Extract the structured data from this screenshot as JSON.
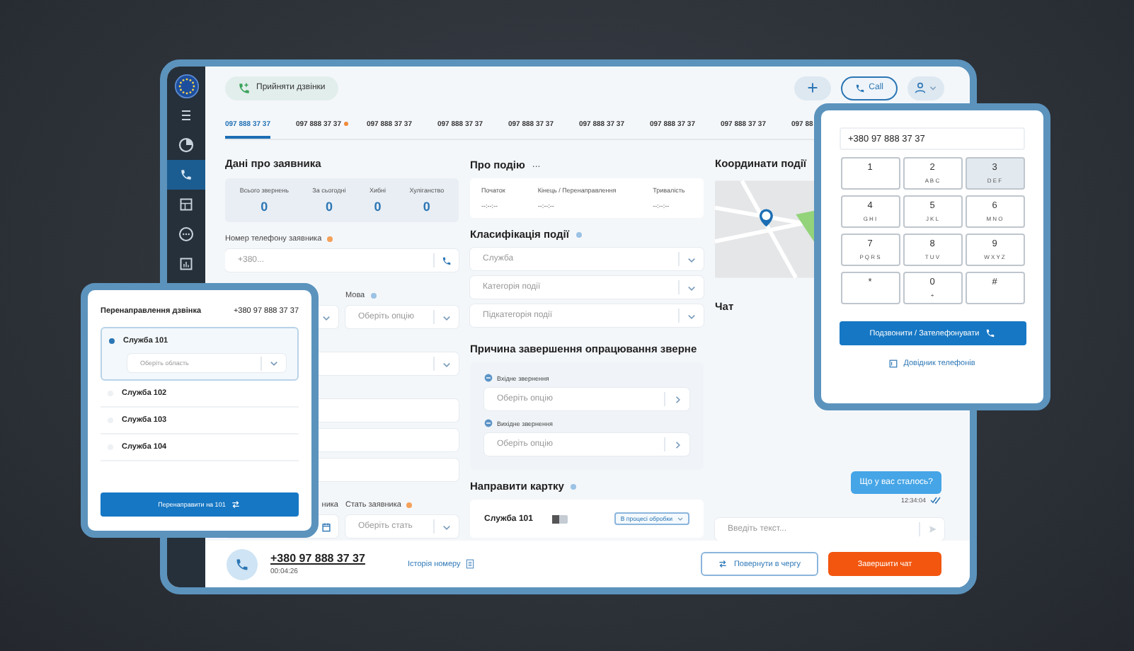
{
  "sidebar": {
    "items": [
      {
        "kind": "logo",
        "selected": false
      },
      {
        "kind": "menu",
        "selected": false
      },
      {
        "kind": "pie",
        "selected": false
      },
      {
        "kind": "phone",
        "selected": true
      },
      {
        "kind": "table",
        "selected": false
      },
      {
        "kind": "chat",
        "selected": false
      },
      {
        "kind": "chart",
        "selected": false
      }
    ]
  },
  "top_bar": {
    "accept_button": "Прийняти дзвінки",
    "call_button": "Call"
  },
  "tabs": [
    {
      "label": "097 888 37 37",
      "selected": true,
      "alert": false
    },
    {
      "label": "097 888 37 37",
      "selected": false,
      "alert": true
    },
    {
      "label": "097 888 37 37",
      "selected": false,
      "alert": false
    },
    {
      "label": "097 888 37 37",
      "selected": false,
      "alert": false
    },
    {
      "label": "097 888 37 37",
      "selected": false,
      "alert": false
    },
    {
      "label": "097 888 37 37",
      "selected": false,
      "alert": false
    },
    {
      "label": "097 888 37 37",
      "selected": false,
      "alert": false
    },
    {
      "label": "097 888 37 37",
      "selected": false,
      "alert": false
    },
    {
      "label": "097 88",
      "selected": false,
      "alert": false
    }
  ],
  "applicant": {
    "title": "Дані про заявника",
    "stats": [
      {
        "label": "Всього звернень",
        "value": "0"
      },
      {
        "label": "За сьогодні",
        "value": "0"
      },
      {
        "label": "Хибні",
        "value": "0"
      },
      {
        "label": "Хуліганство",
        "value": "0"
      }
    ],
    "phone_field": {
      "label": "Номер телефону заявника",
      "marker": {
        "color": "#f4a15a"
      },
      "placeholder": "+380..."
    },
    "language": {
      "label": "Мова",
      "marker": {
        "color": "#9cc2e4"
      },
      "placeholder": "Оберіть опцію"
    },
    "birth_label": "ника",
    "gender": {
      "label": "Стать заявника",
      "marker": {
        "color": "#f4a15a"
      },
      "placeholder": "Оберіть стать"
    }
  },
  "event": {
    "title": "Про подію",
    "more": "...",
    "times": [
      {
        "label": "Початок",
        "value": "--:--:--"
      },
      {
        "label": "Кінець / Перенаправлення",
        "value": "--:--:--"
      },
      {
        "label": "Тривалість",
        "value": "--:--:--"
      }
    ],
    "classification": {
      "title": "Класифікація події",
      "marker": {
        "color": "#9cc2e4"
      },
      "selects": [
        "Служба",
        "Категорія події",
        "Підкатегорія події"
      ]
    },
    "closing": {
      "title": "Причина завершення опрацювання зверне",
      "options": [
        {
          "label": "Вхідне звернення",
          "placeholder": "Оберіть опцію"
        },
        {
          "label": "Вихідне звернення",
          "placeholder": "Оберіть опцію"
        }
      ]
    },
    "route": {
      "title": "Направити картку",
      "marker": {
        "color": "#9cc2e4"
      },
      "rows": [
        {
          "service": "Служба 101",
          "on": false,
          "status": "В процесі обробки"
        }
      ]
    }
  },
  "coordinates": {
    "title": "Координати події"
  },
  "chat": {
    "title": "Чат",
    "messages": [
      {
        "text": "Що у вас сталось?",
        "time": "12:34:04",
        "read": true
      }
    ],
    "input_placeholder": "Введіть текст..."
  },
  "footer": {
    "phone": "+380 97 888 37 37",
    "duration": "00:04:26",
    "history_link": "Історія номеру",
    "return_button": "Повернути в чергу",
    "finish_button": "Завершити чат"
  },
  "dialer": {
    "number": "+380 97 888 37 37",
    "keys": [
      {
        "digit": "1",
        "selected": false
      },
      {
        "digit": "2",
        "letters": "A B C",
        "selected": false
      },
      {
        "digit": "3",
        "letters": "D E F",
        "selected": true
      },
      {
        "digit": "4",
        "letters": "G H I",
        "selected": false
      },
      {
        "digit": "5",
        "letters": "J K L",
        "selected": false
      },
      {
        "digit": "6",
        "letters": "M N O",
        "selected": false
      },
      {
        "digit": "7",
        "letters": "P Q R S",
        "selected": false
      },
      {
        "digit": "8",
        "letters": "T U V",
        "selected": false
      },
      {
        "digit": "9",
        "letters": "W X Y Z",
        "selected": false
      },
      {
        "digit": "*",
        "selected": false
      },
      {
        "digit": "0",
        "letters": "+",
        "selected": false
      },
      {
        "digit": "#",
        "selected": false
      }
    ],
    "call_button": "Подзвонити / Зателефонувати",
    "directory_link": "Довідник телефонів"
  },
  "redirect": {
    "title": "Перенаправлення дзвінка",
    "number": "+380 97 888 37 37",
    "options": [
      {
        "label": "Служба 101",
        "selected": true,
        "region_placeholder": "Оберіть область"
      },
      {
        "label": "Служба 102",
        "selected": false
      },
      {
        "label": "Служба 103",
        "selected": false
      },
      {
        "label": "Служба 104",
        "selected": false
      }
    ],
    "button": "Перенаправити на 101"
  }
}
